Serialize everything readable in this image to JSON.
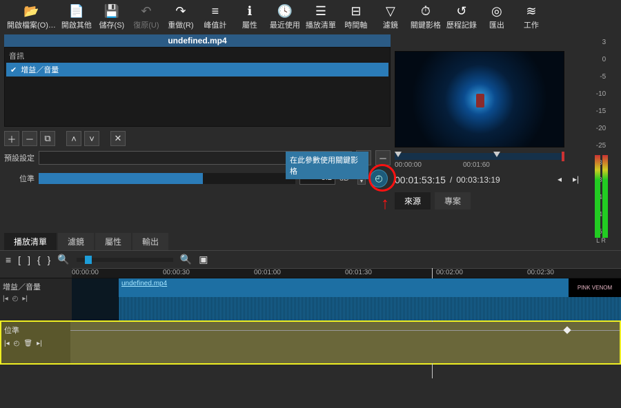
{
  "toolbar": [
    {
      "icon": "folder-open",
      "label": "開啟檔案(O)…"
    },
    {
      "icon": "file-add",
      "label": "開啟其他"
    },
    {
      "icon": "save",
      "label": "儲存(S)"
    },
    {
      "icon": "undo",
      "label": "復原(U)",
      "dim": true
    },
    {
      "icon": "redo",
      "label": "重做(R)"
    },
    {
      "icon": "peak",
      "label": "峰值計"
    },
    {
      "icon": "info",
      "label": "屬性"
    },
    {
      "icon": "clock",
      "label": "最近使用"
    },
    {
      "icon": "playlist",
      "label": "播放清單"
    },
    {
      "icon": "timeline",
      "label": "時間軸"
    },
    {
      "icon": "filter",
      "label": "濾鏡"
    },
    {
      "icon": "keyframe",
      "label": "關鍵影格"
    },
    {
      "icon": "history",
      "label": "歷程記錄"
    },
    {
      "icon": "export",
      "label": "匯出"
    },
    {
      "icon": "jobs",
      "label": "工作"
    }
  ],
  "file_title": "undefined.mp4",
  "audio": {
    "header": "音訊",
    "row": "增益／音量",
    "check": "✔"
  },
  "preset_label": "預設設定",
  "level": {
    "label": "位準",
    "value": "-5.2",
    "unit": "dB"
  },
  "tooltip": "在此參數使用關鍵影格",
  "left_tabs": [
    "播放清單",
    "濾鏡",
    "屬性",
    "輸出"
  ],
  "preview": {
    "scrub_labels": [
      "00:00:00",
      "00:01:60"
    ],
    "timecode": "00:01:53:15",
    "duration": "00:03:13:19"
  },
  "src_tabs": [
    "來源",
    "專案"
  ],
  "meter": {
    "scale": [
      "3",
      "0",
      "-5",
      "-10",
      "-15",
      "-20",
      "-25",
      "-30",
      "-35",
      "-40",
      "-45",
      "-50"
    ],
    "lr": "L R"
  },
  "ruler": [
    "00:00:00",
    "00:00:30",
    "00:01:00",
    "00:01:30",
    "00:02:00",
    "00:02:30"
  ],
  "track": {
    "name": "增益／音量",
    "clip_name": "undefined.mp4",
    "thumb": "PINK VENOM"
  },
  "keytrack": {
    "name": "位準"
  }
}
